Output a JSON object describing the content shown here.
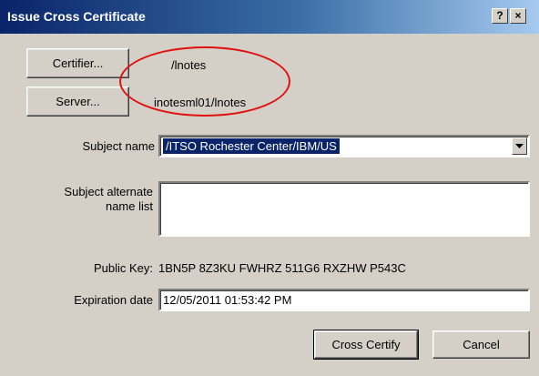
{
  "window": {
    "title": "Issue Cross Certificate",
    "help_button": "?",
    "close_button": "×"
  },
  "buttons": {
    "certifier": "Certifier...",
    "server": "Server...",
    "cross_certify": "Cross Certify",
    "cancel": "Cancel"
  },
  "values": {
    "certifier": "/lnotes",
    "server": "inotesml01/lnotes"
  },
  "form": {
    "subject_name_label": "Subject name",
    "subject_name_value": "/ITSO Rochester Center/IBM/US",
    "alt_name_label_line1": "Subject alternate",
    "alt_name_label_line2": "name list",
    "alt_name_value": "",
    "public_key_label": "Public Key:",
    "public_key_value": "1BN5P 8Z3KU FWHRZ 511G6 RXZHW P543C",
    "expiration_label": "Expiration date",
    "expiration_value": "12/05/2011 01:53:42 PM"
  },
  "colors": {
    "annotation_circle": "#e01010",
    "selection": "#0a246a"
  }
}
